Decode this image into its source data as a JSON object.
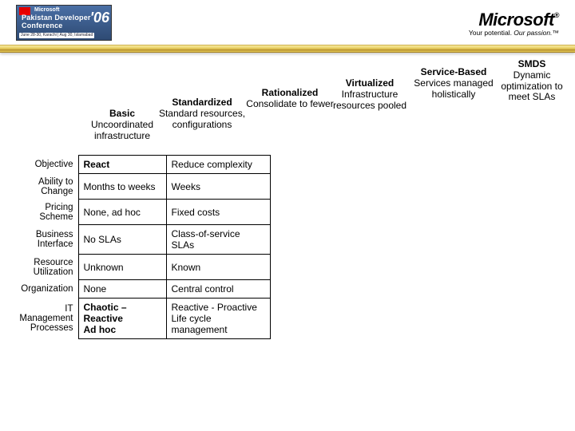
{
  "header": {
    "badge": {
      "brand": "Microsoft",
      "line1": "Pakistan Developer",
      "line2": "Conference",
      "year": "'06",
      "dates": "June 28-30, Karachi | Aug 30, Islamabad"
    },
    "brand": {
      "name": "Microsoft",
      "reg": "®",
      "tagline_pre": "Your potential. ",
      "tagline_em": "Our passion.™"
    }
  },
  "levels": [
    {
      "title": "Basic",
      "desc": "Uncoordinated infrastructure"
    },
    {
      "title": "Standardized",
      "desc": "Standard resources, configurations"
    },
    {
      "title": "Rationalized",
      "desc": "Consolidate to fewer"
    },
    {
      "title": "Virtualized",
      "desc": "Infrastructure resources pooled"
    },
    {
      "title": "Service-Based",
      "desc": "Services managed holistically"
    },
    {
      "title": "SMDS",
      "desc": "Dynamic optimization to meet SLAs"
    }
  ],
  "rows": [
    {
      "label": "Objective",
      "basic": "React",
      "std": "Reduce complexity"
    },
    {
      "label": "Ability to Change",
      "basic": "Months to weeks",
      "std": "Weeks"
    },
    {
      "label": "Pricing Scheme",
      "basic": "None, ad hoc",
      "std": "Fixed costs"
    },
    {
      "label": "Business Interface",
      "basic": "No SLAs",
      "std": "Class-of-service SLAs"
    },
    {
      "label": "Resource Utilization",
      "basic": "Unknown",
      "std": "Known"
    },
    {
      "label": "Organization",
      "basic": "None",
      "std": "Central control"
    },
    {
      "label": "IT Management Processes",
      "basic": "Chaotic – Reactive\nAd hoc",
      "std": "Reactive - Proactive\nLife cycle management"
    }
  ]
}
